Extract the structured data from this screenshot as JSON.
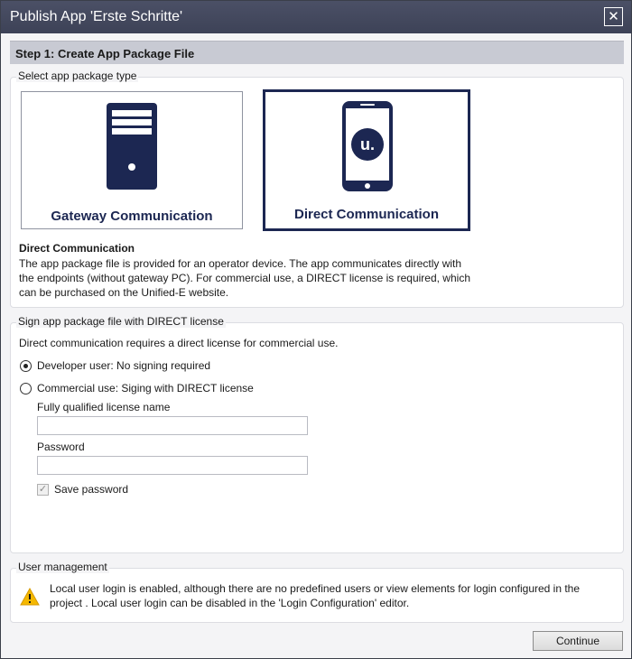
{
  "window": {
    "title": "Publish App 'Erste Schritte'",
    "close_glyph": "✕"
  },
  "step": {
    "title": "Step 1: Create App Package File"
  },
  "package_type": {
    "group_label": "Select app package type",
    "options": [
      {
        "label": "Gateway Communication",
        "icon": "server-tower-icon",
        "selected": false
      },
      {
        "label": "Direct Communication",
        "icon": "smartphone-icon",
        "selected": true
      }
    ],
    "phone_logo_text": "u.",
    "description_title": "Direct Communication",
    "description_text": "The app package file is provided for an operator device. The app communicates directly with the endpoints (without gateway PC). For commercial use, a DIRECT license is required, which can be purchased on the Unified-E website."
  },
  "license": {
    "group_label": "Sign app package file with DIRECT license",
    "intro": "Direct communication requires a direct license for commercial use.",
    "radio_developer": "Developer user: No signing required",
    "radio_commercial": "Commercial use: Siging with DIRECT license",
    "selected": "developer",
    "license_name_label": "Fully qualified license name",
    "license_name_value": "",
    "password_label": "Password",
    "password_value": "",
    "save_password_label": "Save password",
    "save_password_checked": true
  },
  "user_management": {
    "group_label": "User management",
    "warning_text": "Local user login is enabled, although there are no predefined users or view elements for login configured in the project . Local user login can be disabled in the 'Login Configuration' editor."
  },
  "footer": {
    "continue_label": "Continue"
  },
  "colors": {
    "titlebar": "#444a60",
    "accent": "#1c2752",
    "warning": "#f5b800"
  }
}
